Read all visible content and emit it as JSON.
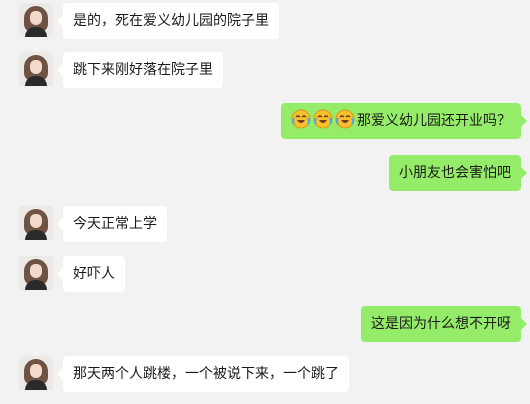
{
  "messages": [
    {
      "side": "in",
      "text": "是的，死在爱义幼儿园的院子里"
    },
    {
      "side": "in",
      "text": "跳下来刚好落在院子里"
    },
    {
      "side": "out",
      "emojis": [
        "laughing-crying-face",
        "laughing-crying-face",
        "laughing-crying-face"
      ],
      "text": "那爱义幼儿园还开业吗？"
    },
    {
      "side": "out",
      "text": "小朋友也会害怕吧"
    },
    {
      "side": "in",
      "text": "今天正常上学"
    },
    {
      "side": "in",
      "text": "好吓人"
    },
    {
      "side": "out",
      "text": "这是因为什么想不开呀"
    },
    {
      "side": "in",
      "text": "那天两个人跳楼，一个被说下来，一个跳了"
    }
  ],
  "colors": {
    "background": "#f2f2f2",
    "incoming_bubble": "#ffffff",
    "outgoing_bubble": "#95ec69"
  }
}
